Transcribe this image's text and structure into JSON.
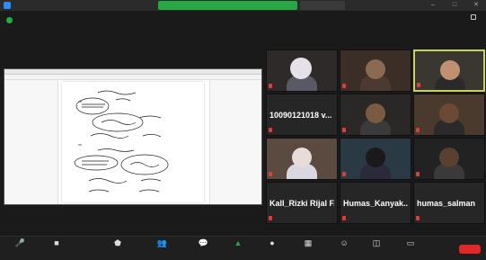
{
  "window": {
    "title": "",
    "share_banner": "",
    "view_options_label": "",
    "controls": [
      "–",
      "□",
      "✕"
    ]
  },
  "corner": {
    "view_label": ""
  },
  "participants": [
    {
      "big_name": "",
      "label": ""
    },
    {
      "big_name": "",
      "label": ""
    },
    {
      "big_name": "",
      "label": "",
      "active": true
    },
    {
      "big_name": "10090121018 v...",
      "label": ""
    },
    {
      "big_name": "",
      "label": ""
    },
    {
      "big_name": "",
      "label": ""
    },
    {
      "big_name": "",
      "label": ""
    },
    {
      "big_name": "",
      "label": ""
    },
    {
      "big_name": "",
      "label": ""
    },
    {
      "big_name": "Kall_Rizki Rijal F...",
      "label": ""
    },
    {
      "big_name": "Humas_Kanyak...",
      "label": ""
    },
    {
      "big_name": "humas_salman",
      "label": ""
    }
  ],
  "toolbar": {
    "unmute": {
      "icon": "🎤",
      "label": ""
    },
    "video": {
      "icon": "■",
      "label": ""
    },
    "security": {
      "icon": "⬟",
      "label": ""
    },
    "participants": {
      "icon": "👥",
      "label": ""
    },
    "chat": {
      "icon": "💬",
      "label": ""
    },
    "share": {
      "icon": "▲",
      "label": ""
    },
    "record": {
      "icon": "●",
      "label": ""
    },
    "breakout": {
      "icon": "▦",
      "label": ""
    },
    "reactions": {
      "icon": "☺",
      "label": ""
    },
    "apps": {
      "icon": "◫",
      "label": ""
    },
    "whiteboards": {
      "icon": "▭",
      "label": ""
    },
    "end_label": ""
  },
  "colors": {
    "share_banner": "#27a844",
    "active_speaker_border": "#c9d35a",
    "end_button": "#e02828",
    "muted_icon": "#e23b3b"
  }
}
